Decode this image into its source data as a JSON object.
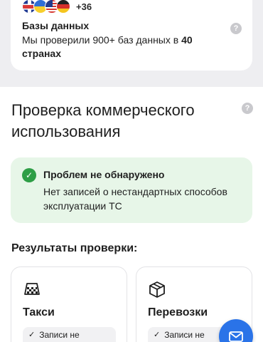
{
  "databases": {
    "flags": [
      "uk-flag-icon",
      "ukraine-flag-icon",
      "us-flag-icon",
      "germany-flag-icon"
    ],
    "more_count": "+36",
    "title": "Базы данных",
    "desc_prefix": "Мы проверили 900+ баз данных в ",
    "desc_bold": "40 странах",
    "help": "?"
  },
  "commercial": {
    "title": "Проверка коммерческого использования",
    "help": "?",
    "status": {
      "icon": "check-circle-icon",
      "icon_glyph": "✓",
      "title": "Проблем не обнаружено",
      "description": "Нет записей о нестандартных способов эксплуатации ТС",
      "color": "#2e9e46",
      "background": "#e7f6e8"
    }
  },
  "results": {
    "label": "Результаты проверки:",
    "cards": [
      {
        "icon": "taxi-icon",
        "title": "Такси",
        "chip_check": "✓",
        "chip_text": "Записи не"
      },
      {
        "icon": "box-icon",
        "title": "Перевозки",
        "chip_check": "✓",
        "chip_text": "Записи не"
      }
    ]
  },
  "fab": {
    "icon": "mail-icon",
    "color": "#2a73e8"
  }
}
